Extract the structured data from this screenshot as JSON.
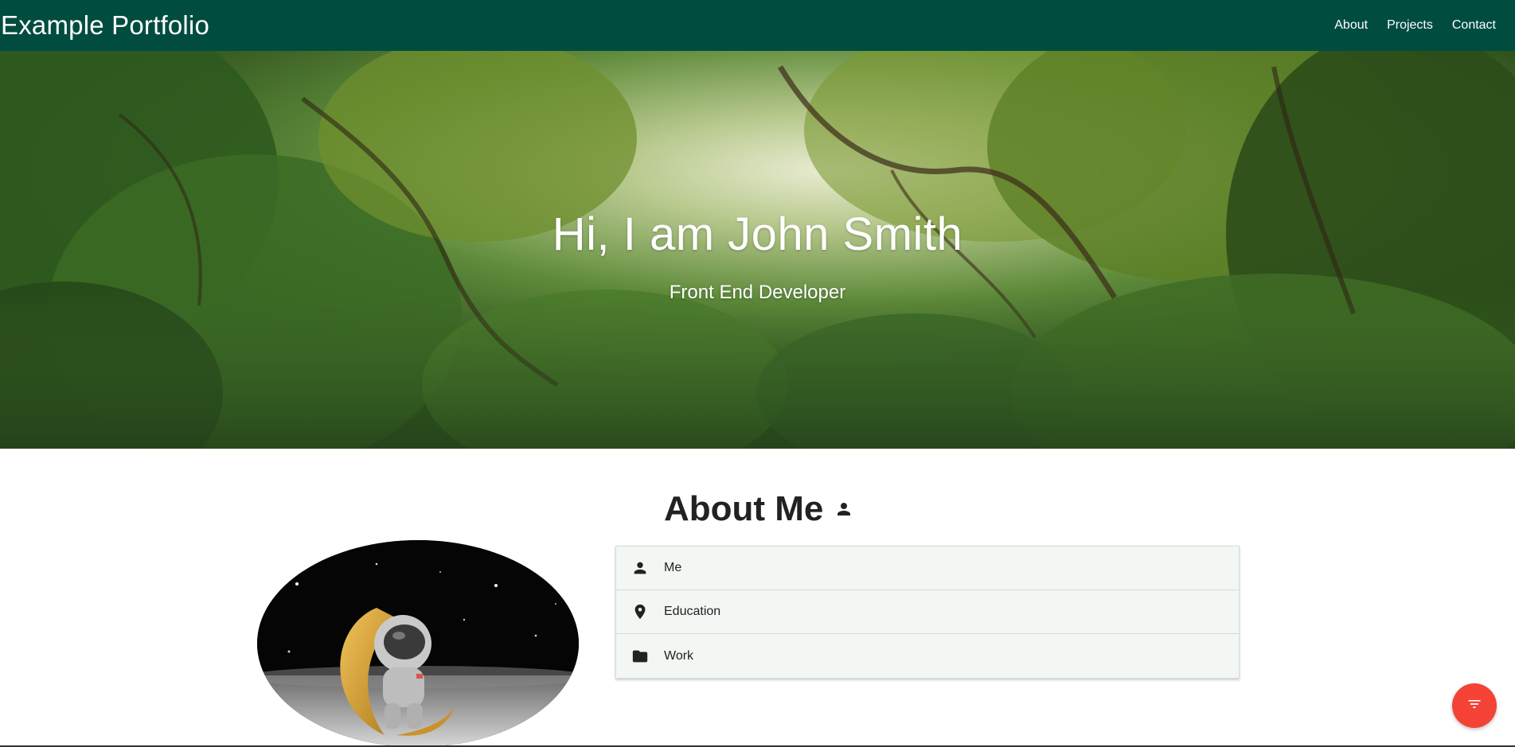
{
  "navbar": {
    "brand": "Example Portfolio",
    "links": [
      "About",
      "Projects",
      "Contact"
    ],
    "background": "#004d40"
  },
  "hero": {
    "title": "Hi, I am John Smith",
    "subtitle": "Front End Developer"
  },
  "about": {
    "title": "About Me",
    "title_icon": "person-icon",
    "items": [
      {
        "label": "Me",
        "icon": "person-icon"
      },
      {
        "label": "Education",
        "icon": "place-icon"
      },
      {
        "label": "Work",
        "icon": "folder-icon"
      }
    ]
  },
  "fab": {
    "icon": "filter-list-icon",
    "color": "#f44336"
  }
}
